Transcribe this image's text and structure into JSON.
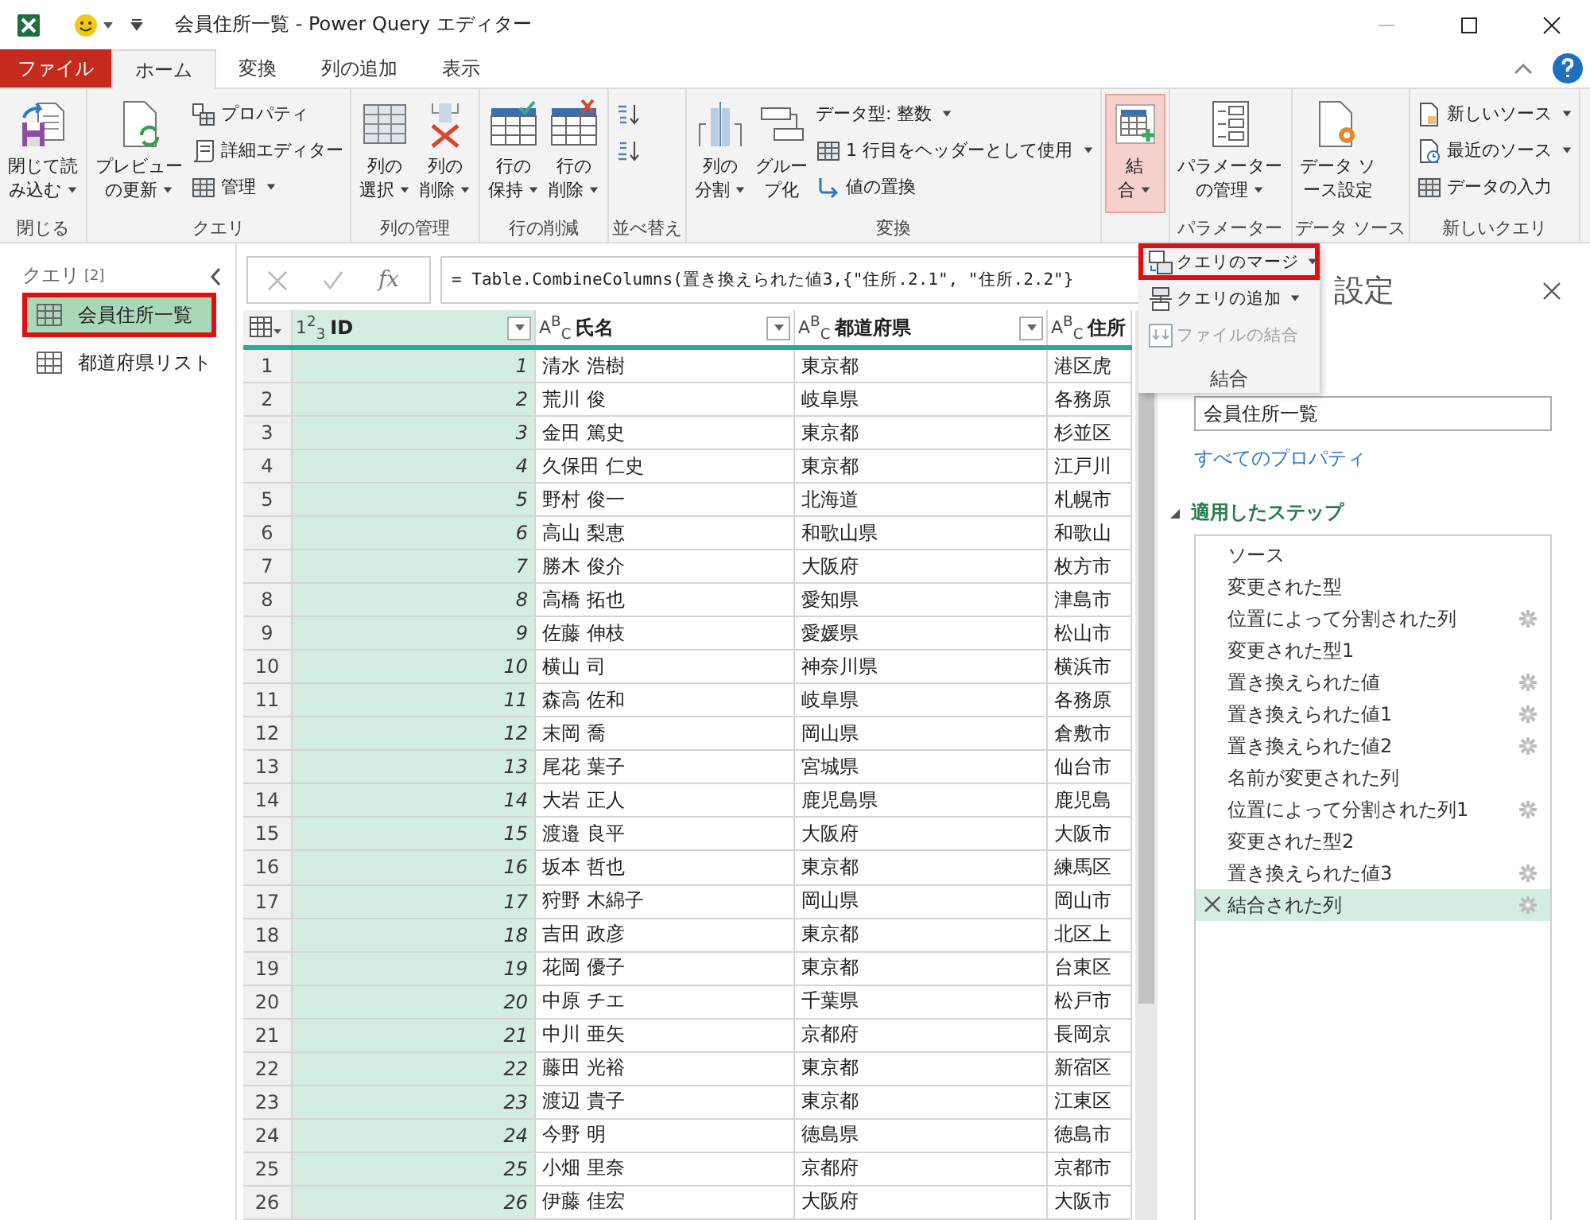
{
  "window": {
    "title": "会員住所一覧 - Power Query エディター"
  },
  "tabs": [
    {
      "label": "ファイル",
      "kind": "file",
      "selected": false
    },
    {
      "label": "ホーム",
      "kind": "tab",
      "selected": true
    },
    {
      "label": "変換",
      "kind": "tab",
      "selected": false
    },
    {
      "label": "列の追加",
      "kind": "tab",
      "selected": false
    },
    {
      "label": "表示",
      "kind": "tab",
      "selected": false
    }
  ],
  "ribbon": {
    "groups": [
      {
        "label": "閉じる",
        "buttons": [
          {
            "kind": "large",
            "lines": [
              "閉じて読",
              "み込む"
            ],
            "dropdown": true,
            "selected": false
          }
        ]
      },
      {
        "label": "クエリ",
        "buttons": [
          {
            "kind": "large",
            "lines": [
              "プレビュー",
              "の更新"
            ],
            "dropdown": true,
            "selected": false
          },
          {
            "kind": "small",
            "label": "プロパティ",
            "dropdown": false,
            "selected": false
          },
          {
            "kind": "small",
            "label": "詳細エディター",
            "dropdown": false,
            "selected": false
          },
          {
            "kind": "small",
            "label": "管理",
            "dropdown": true,
            "selected": false
          }
        ]
      },
      {
        "label": "列の管理",
        "buttons": [
          {
            "kind": "large",
            "lines": [
              "列の",
              "選択"
            ],
            "dropdown": true,
            "selected": false
          },
          {
            "kind": "large",
            "lines": [
              "列の",
              "削除"
            ],
            "dropdown": true,
            "selected": false
          }
        ]
      },
      {
        "label": "行の削減",
        "buttons": [
          {
            "kind": "large",
            "lines": [
              "行の",
              "保持"
            ],
            "dropdown": true,
            "selected": false
          },
          {
            "kind": "large",
            "lines": [
              "行の",
              "削除"
            ],
            "dropdown": true,
            "selected": false
          }
        ]
      },
      {
        "label": "並べ替え",
        "buttons": [
          {
            "kind": "small",
            "dropdown": false,
            "selected": false
          },
          {
            "kind": "small",
            "dropdown": false,
            "selected": false
          }
        ]
      },
      {
        "label": "変換",
        "buttons": [
          {
            "kind": "large",
            "lines": [
              "列の",
              "分割"
            ],
            "dropdown": true,
            "selected": false
          },
          {
            "kind": "large",
            "lines": [
              "グルー",
              "プ化"
            ],
            "dropdown": false,
            "selected": false
          },
          {
            "kind": "small",
            "label": "データ型: 整数",
            "dropdown": true,
            "selected": false
          },
          {
            "kind": "small",
            "label": "1 行目をヘッダーとして使用",
            "dropdown": true,
            "selected": false
          },
          {
            "kind": "small",
            "label": "値の置換",
            "dropdown": false,
            "selected": false
          }
        ]
      },
      {
        "buttons": [
          {
            "kind": "large",
            "lines": [
              "結",
              "合"
            ],
            "dropdown": true,
            "selected": true
          }
        ]
      },
      {
        "label": "パラメーター",
        "buttons": [
          {
            "kind": "large",
            "lines": [
              "パラメーター",
              "の管理"
            ],
            "dropdown": true,
            "selected": false
          }
        ]
      },
      {
        "label": "データ ソース",
        "buttons": [
          {
            "kind": "large",
            "lines": [
              "データ ソ",
              "ース設定"
            ],
            "dropdown": false,
            "selected": false
          }
        ]
      },
      {
        "label": "新しいクエリ",
        "buttons": [
          {
            "kind": "small",
            "label": "新しいソース",
            "dropdown": true,
            "selected": false
          },
          {
            "kind": "small",
            "label": "最近のソース",
            "dropdown": true,
            "selected": false
          },
          {
            "kind": "small",
            "label": "データの入力",
            "dropdown": false,
            "selected": false
          }
        ]
      }
    ]
  },
  "merge_menu": {
    "items": [
      {
        "label": "クエリのマージ",
        "dropdown": true,
        "disabled": false,
        "callout": true
      },
      {
        "label": "クエリの追加",
        "dropdown": true,
        "disabled": false,
        "callout": false
      },
      {
        "label": "ファイルの結合",
        "dropdown": false,
        "disabled": true,
        "callout": false
      }
    ],
    "caption": "結合"
  },
  "queries": {
    "title": "クエリ",
    "count": "[2]",
    "items": [
      {
        "label": "会員住所一覧",
        "selected": true,
        "callout": true
      },
      {
        "label": "都道府県リスト",
        "selected": false,
        "callout": false
      }
    ]
  },
  "formula_bar": {
    "fx": "fx",
    "formula": "= Table.CombineColumns(置き換えられた値3,{\"住所.2.1\", \"住所.2.2\"}"
  },
  "table": {
    "columns": [
      {
        "type_icon": "1$^{2}$$_{3}$",
        "name": "ID",
        "kind": "number",
        "selected": true
      },
      {
        "type_icon": "A$^{B}$$_{C}$",
        "name": "氏名",
        "kind": "text",
        "selected": false
      },
      {
        "type_icon": "A$^{B}$$_{C}$",
        "name": "都道府県",
        "kind": "text",
        "selected": false
      },
      {
        "type_icon": "A$^{B}$$_{C}$",
        "name": "住所",
        "kind": "text",
        "selected": false
      }
    ],
    "rows": [
      {
        "n": "1",
        "cells": [
          "1",
          "清水 浩樹",
          "東京都",
          "港区虎"
        ]
      },
      {
        "n": "2",
        "cells": [
          "2",
          "荒川 俊",
          "岐阜県",
          "各務原"
        ]
      },
      {
        "n": "3",
        "cells": [
          "3",
          "金田 篤史",
          "東京都",
          "杉並区"
        ]
      },
      {
        "n": "4",
        "cells": [
          "4",
          "久保田 仁史",
          "東京都",
          "江戸川"
        ]
      },
      {
        "n": "5",
        "cells": [
          "5",
          "野村 俊一",
          "北海道",
          "札幌市"
        ]
      },
      {
        "n": "6",
        "cells": [
          "6",
          "高山 梨恵",
          "和歌山県",
          "和歌山"
        ]
      },
      {
        "n": "7",
        "cells": [
          "7",
          "勝木 俊介",
          "大阪府",
          "枚方市"
        ]
      },
      {
        "n": "8",
        "cells": [
          "8",
          "高橋 拓也",
          "愛知県",
          "津島市"
        ]
      },
      {
        "n": "9",
        "cells": [
          "9",
          "佐藤 伸枝",
          "愛媛県",
          "松山市"
        ]
      },
      {
        "n": "10",
        "cells": [
          "10",
          "横山 司",
          "神奈川県",
          "横浜市"
        ]
      },
      {
        "n": "11",
        "cells": [
          "11",
          "森高 佐和",
          "岐阜県",
          "各務原"
        ]
      },
      {
        "n": "12",
        "cells": [
          "12",
          "末岡 喬",
          "岡山県",
          "倉敷市"
        ]
      },
      {
        "n": "13",
        "cells": [
          "13",
          "尾花 葉子",
          "宮城県",
          "仙台市"
        ]
      },
      {
        "n": "14",
        "cells": [
          "14",
          "大岩 正人",
          "鹿児島県",
          "鹿児島"
        ]
      },
      {
        "n": "15",
        "cells": [
          "15",
          "渡邉 良平",
          "大阪府",
          "大阪市"
        ]
      },
      {
        "n": "16",
        "cells": [
          "16",
          "坂本 哲也",
          "東京都",
          "練馬区"
        ]
      },
      {
        "n": "17",
        "cells": [
          "17",
          "狩野 木綿子",
          "岡山県",
          "岡山市"
        ]
      },
      {
        "n": "18",
        "cells": [
          "18",
          "吉田 政彦",
          "東京都",
          "北区上"
        ]
      },
      {
        "n": "19",
        "cells": [
          "19",
          "花岡 優子",
          "東京都",
          "台東区"
        ]
      },
      {
        "n": "20",
        "cells": [
          "20",
          "中原 チエ",
          "千葉県",
          "松戸市"
        ]
      },
      {
        "n": "21",
        "cells": [
          "21",
          "中川 亜矢",
          "京都府",
          "長岡京"
        ]
      },
      {
        "n": "22",
        "cells": [
          "22",
          "藤田 光裕",
          "東京都",
          "新宿区"
        ]
      },
      {
        "n": "23",
        "cells": [
          "23",
          "渡辺 貴子",
          "東京都",
          "江東区"
        ]
      },
      {
        "n": "24",
        "cells": [
          "24",
          "今野 明",
          "徳島県",
          "徳島市"
        ]
      },
      {
        "n": "25",
        "cells": [
          "25",
          "小畑 里奈",
          "京都府",
          "京都市"
        ]
      },
      {
        "n": "26",
        "cells": [
          "26",
          "伊藤 佳宏",
          "大阪府",
          "大阪市"
        ]
      }
    ]
  },
  "settings": {
    "title": "設定",
    "name_value": "会員住所一覧",
    "properties_link": "すべてのプロパティ",
    "steps_title": "適用したステップ",
    "steps_expanded": true,
    "steps": [
      {
        "label": "ソース",
        "settings": false,
        "selected": false
      },
      {
        "label": "変更された型",
        "settings": false,
        "selected": false
      },
      {
        "label": "位置によって分割された列",
        "settings": true,
        "selected": false
      },
      {
        "label": "変更された型1",
        "settings": false,
        "selected": false
      },
      {
        "label": "置き換えられた値",
        "settings": true,
        "selected": false
      },
      {
        "label": "置き換えられた値1",
        "settings": true,
        "selected": false
      },
      {
        "label": "置き換えられた値2",
        "settings": true,
        "selected": false
      },
      {
        "label": "名前が変更された列",
        "settings": false,
        "selected": false
      },
      {
        "label": "位置によって分割された列1",
        "settings": true,
        "selected": false
      },
      {
        "label": "変更された型2",
        "settings": false,
        "selected": false
      },
      {
        "label": "置き換えられた値3",
        "settings": true,
        "selected": false
      },
      {
        "label": "結合された列",
        "settings": true,
        "selected": true
      }
    ]
  }
}
